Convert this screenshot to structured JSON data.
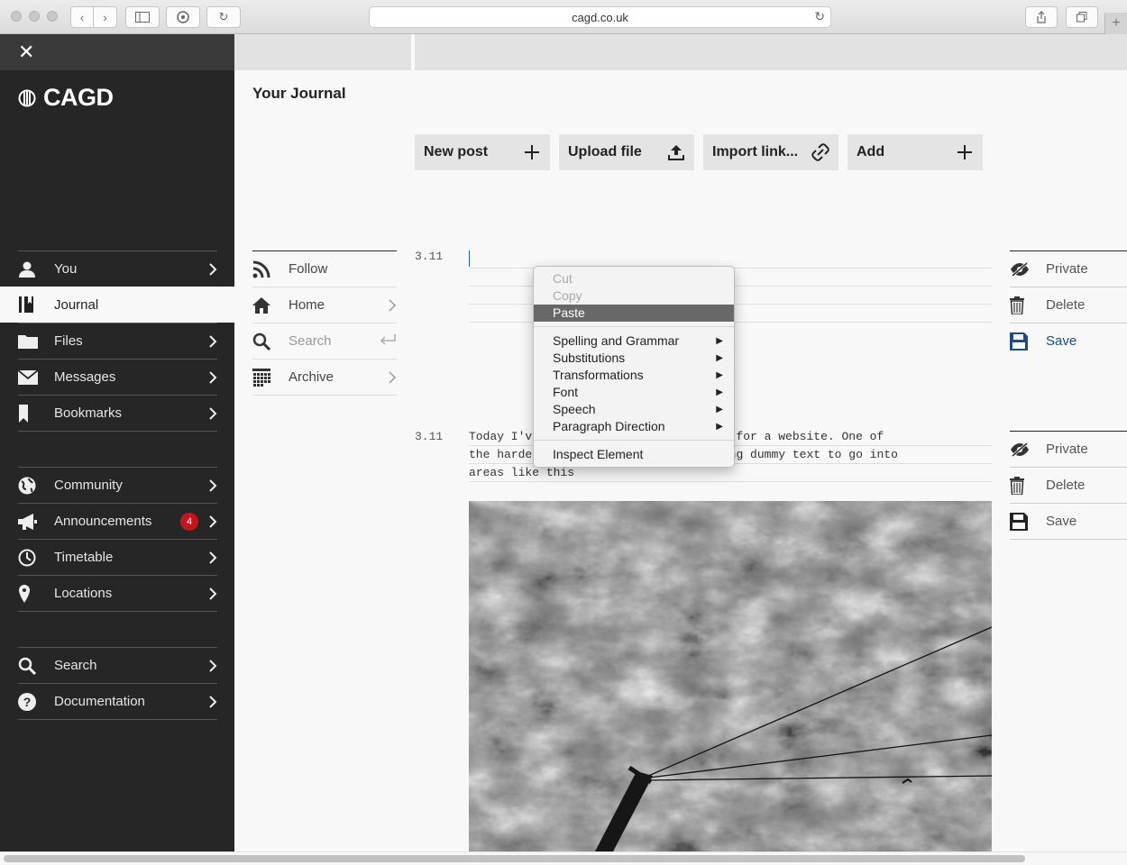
{
  "browser": {
    "url": "cagd.co.uk",
    "buttons": [
      "back",
      "forward",
      "sidebar",
      "tabs",
      "reload",
      "share",
      "tab-overview",
      "new-tab"
    ]
  },
  "sidebar": {
    "close": "✕",
    "logo": "CAGD",
    "groups": [
      [
        {
          "label": "You",
          "icon": "person-icon"
        },
        {
          "label": "Journal",
          "icon": "journal-icon",
          "active": true
        },
        {
          "label": "Files",
          "icon": "folder-icon"
        },
        {
          "label": "Messages",
          "icon": "envelope-icon"
        },
        {
          "label": "Bookmarks",
          "icon": "bookmark-icon"
        }
      ],
      [
        {
          "label": "Community",
          "icon": "globe-icon"
        },
        {
          "label": "Announcements",
          "icon": "megaphone-icon",
          "badge": "4"
        },
        {
          "label": "Timetable",
          "icon": "clock-icon"
        },
        {
          "label": "Locations",
          "icon": "pin-icon"
        }
      ],
      [
        {
          "label": "Search",
          "icon": "search-icon"
        },
        {
          "label": "Documentation",
          "icon": "help-icon"
        }
      ]
    ]
  },
  "main": {
    "title": "Your Journal",
    "actions": [
      {
        "label": "New post",
        "icon": "plus-icon"
      },
      {
        "label": "Upload file",
        "icon": "upload-icon"
      },
      {
        "label": "Import link...",
        "icon": "link-icon"
      },
      {
        "label": "Add",
        "icon": "plus-icon"
      }
    ],
    "subnav": [
      {
        "label": "Follow",
        "icon": "rss-icon"
      },
      {
        "label": "Home",
        "icon": "home-icon"
      },
      {
        "label": "Search",
        "icon": "search-icon",
        "placeholder": true
      },
      {
        "label": "Archive",
        "icon": "calendar-icon"
      }
    ],
    "posts": [
      {
        "date": "3.11",
        "lines": [
          "",
          "",
          "",
          ""
        ],
        "actions": [
          "Private",
          "Delete",
          "Save"
        ]
      },
      {
        "date": "3.11",
        "lines": [
          "Today I've been writing documentation for a website. One of",
          "the hardest parts of the job is writing dummy text to go into",
          "areas like this"
        ],
        "actions": [
          "Private",
          "Delete",
          "Save"
        ]
      }
    ]
  },
  "context_menu": {
    "items": [
      {
        "label": "Cut",
        "disabled": true
      },
      {
        "label": "Copy",
        "disabled": true
      },
      {
        "label": "Paste",
        "highlighted": true
      },
      {
        "separator": true
      },
      {
        "label": "Spelling and Grammar",
        "submenu": true
      },
      {
        "label": "Substitutions",
        "submenu": true
      },
      {
        "label": "Transformations",
        "submenu": true
      },
      {
        "label": "Font",
        "submenu": true
      },
      {
        "label": "Speech",
        "submenu": true
      },
      {
        "label": "Paragraph Direction",
        "submenu": true
      },
      {
        "separator": true
      },
      {
        "label": "Inspect Element"
      }
    ]
  },
  "colors": {
    "sidebar": "#262626",
    "accent_blue": "#1d4a8c",
    "badge_red": "#c3161c"
  }
}
